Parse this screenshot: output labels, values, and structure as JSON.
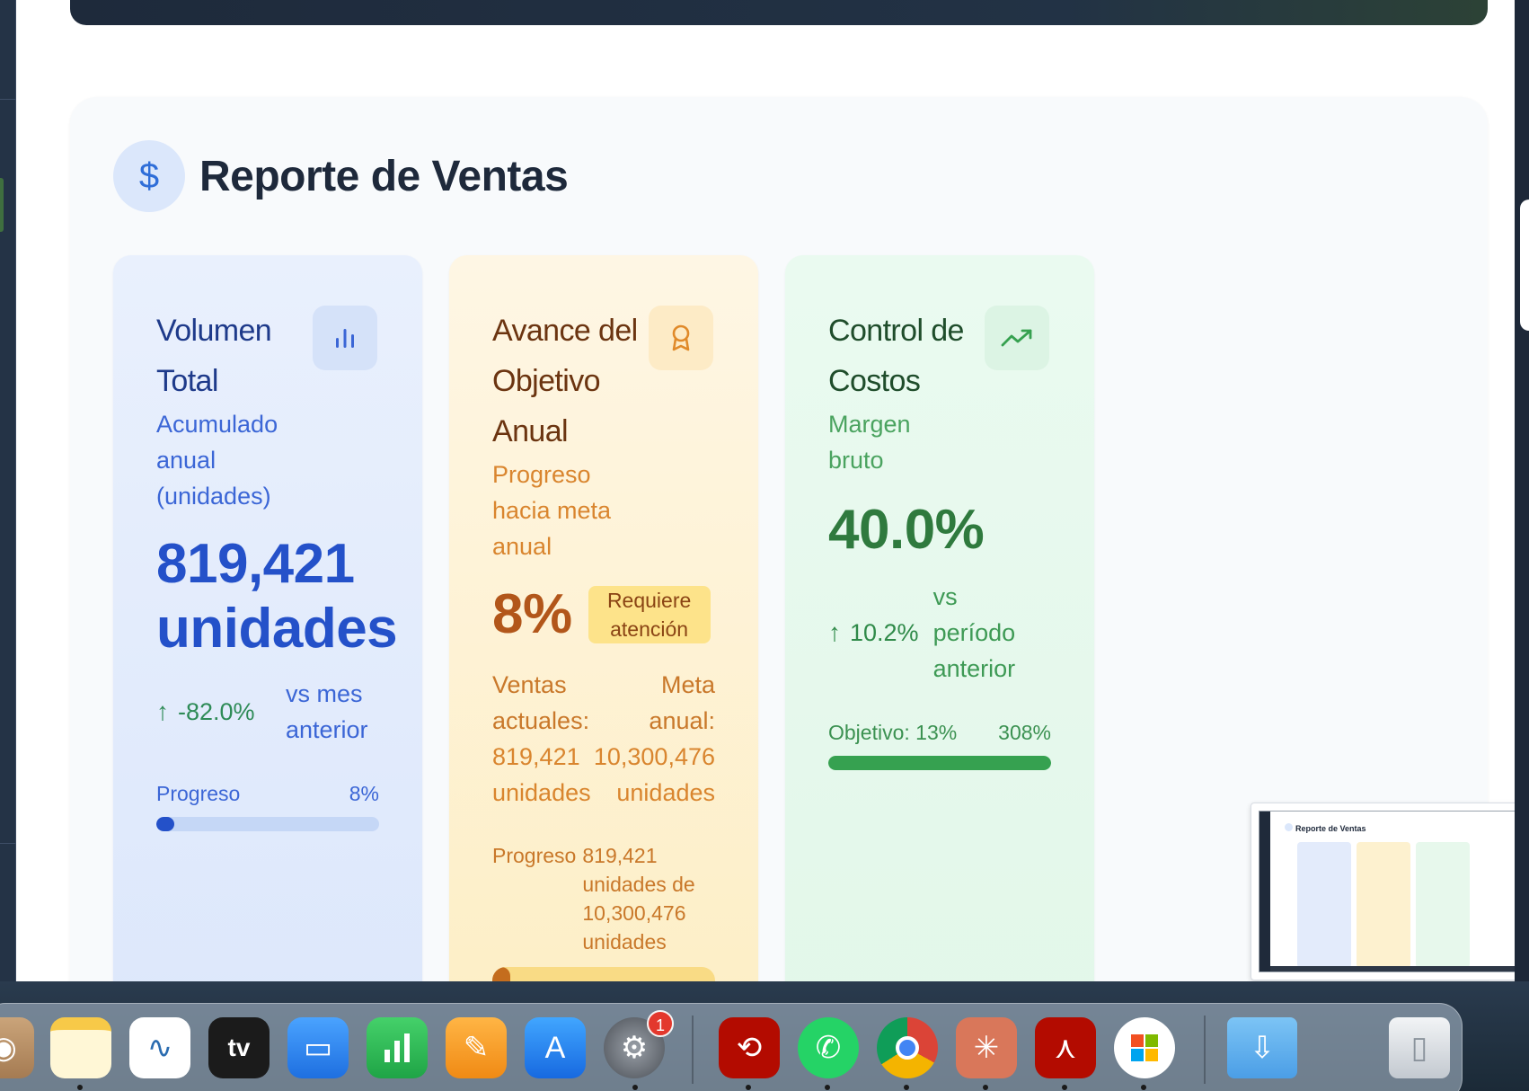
{
  "section": {
    "title": "Reporte de Ventas",
    "icon": "dollar-icon"
  },
  "cards": {
    "volume": {
      "title": "Volumen Total",
      "subtitle": "Acumulado anual (unidades)",
      "value": "819,421 unidades",
      "trend_arrow": "↑",
      "trend_change": "-82.0%",
      "trend_label": "vs mes anterior",
      "progress_label": "Progreso",
      "progress_percent": "8%",
      "progress_fraction": 0.08,
      "icon": "bar-chart-icon",
      "accent_color": "#2451c9"
    },
    "goal": {
      "title": "Avance del Objetivo Anual",
      "subtitle": "Progreso hacia meta anual",
      "value": "8%",
      "badge": "Requiere atención",
      "current_label": "Ventas actuales:",
      "current_value": "819,421 unidades",
      "target_label": "Meta anual:",
      "target_value": "10,300,476 unidades",
      "progress_label": "Progreso",
      "progress_detail": "819,421 unidades de 10,300,476 unidades",
      "progress_fraction": 0.08,
      "icon": "award-ribbon-icon",
      "accent_color": "#b2561a"
    },
    "costs": {
      "title": "Control de Costos",
      "subtitle": "Margen bruto",
      "value": "40.0%",
      "trend_arrow": "↑",
      "trend_change": "10.2%",
      "trend_label": "vs período anterior",
      "objective_label": "Objetivo: 13%",
      "objective_percent": "308%",
      "progress_fraction": 1.0,
      "icon": "trending-up-icon",
      "accent_color": "#2f7a3e"
    }
  },
  "preview": {
    "title": "Reporte de Ventas"
  },
  "dock": {
    "items": [
      {
        "name": "contacts",
        "icon": "contacts-icon"
      },
      {
        "name": "notes",
        "icon": "notes-icon"
      },
      {
        "name": "freeform",
        "icon": "freeform-icon"
      },
      {
        "name": "tv",
        "icon": "appletv-icon",
        "label": "tv"
      },
      {
        "name": "keynote",
        "icon": "keynote-icon"
      },
      {
        "name": "numbers",
        "icon": "numbers-icon"
      },
      {
        "name": "pages",
        "icon": "pages-icon"
      },
      {
        "name": "app-store",
        "icon": "app-store-icon"
      },
      {
        "name": "system-settings",
        "icon": "gear-icon",
        "badge": "1"
      },
      {
        "name": "acrobat-sync",
        "icon": "acrobat-sync-icon"
      },
      {
        "name": "whatsapp",
        "icon": "whatsapp-icon"
      },
      {
        "name": "chrome",
        "icon": "chrome-icon"
      },
      {
        "name": "claude",
        "icon": "claude-icon"
      },
      {
        "name": "acrobat",
        "icon": "acrobat-icon"
      },
      {
        "name": "microsoft-installer",
        "icon": "microsoft-installer-icon"
      },
      {
        "name": "downloads",
        "icon": "downloads-folder-icon"
      },
      {
        "name": "trash",
        "icon": "trash-icon"
      }
    ]
  }
}
